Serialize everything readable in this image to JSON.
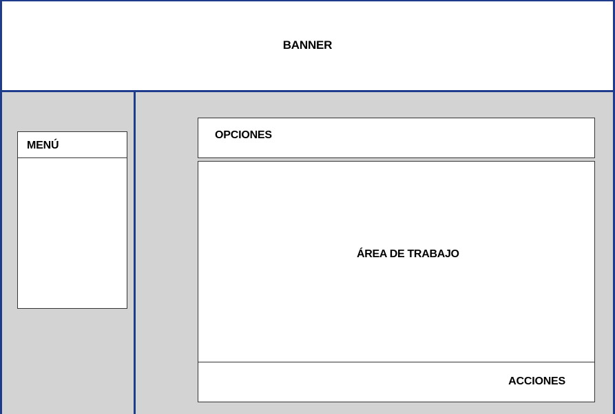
{
  "banner": {
    "label": "BANNER"
  },
  "menu": {
    "label": "MENÚ"
  },
  "options": {
    "label": "OPCIONES"
  },
  "work_area": {
    "label": "ÁREA DE TRABAJO"
  },
  "actions": {
    "label": "ACCIONES"
  },
  "colors": {
    "frame_border": "#1f3b8c",
    "panel_background": "#d3d3d3",
    "box_background": "#ffffff",
    "box_border": "#333333"
  }
}
